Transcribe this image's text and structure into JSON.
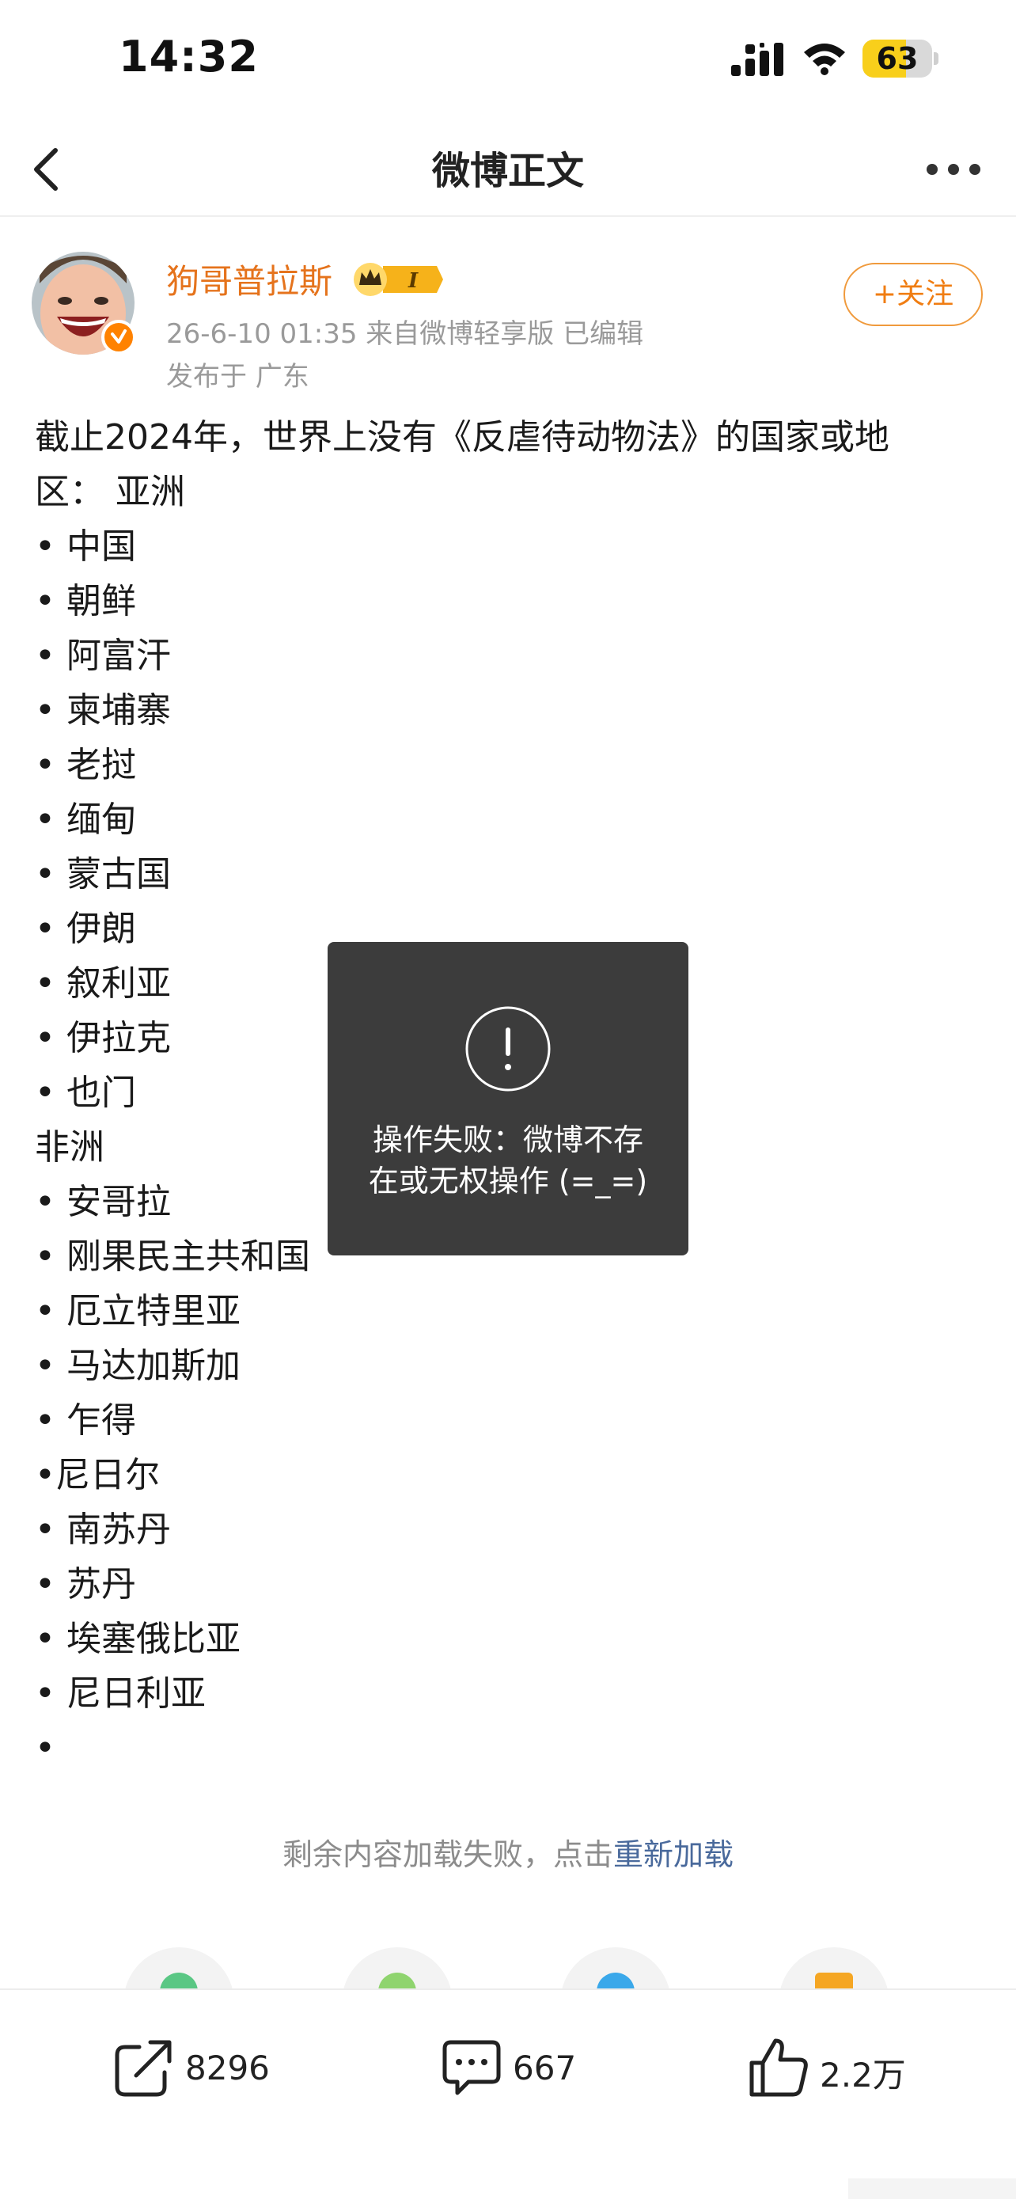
{
  "status_bar": {
    "time": "14:32",
    "battery_level": "63",
    "battery_fraction": 0.63
  },
  "nav": {
    "title": "微博正文"
  },
  "author": {
    "name": "狗哥普拉斯",
    "meta": "26-6-10 01:35  来自微博轻享版  已编辑",
    "location": "发布于 广东",
    "follow_label": "+关注"
  },
  "post": {
    "lines": [
      "截止2024年，世界上没有《反虐待动物法》的国家或地",
      "区： 亚洲",
      "• 中国",
      "• 朝鲜",
      "• 阿富汗",
      "• 柬埔寨",
      "• 老挝",
      "• 缅甸",
      "• 蒙古国",
      "• 伊朗",
      "• 叙利亚",
      "• 伊拉克",
      "• 也门",
      "非洲",
      "• 安哥拉",
      "• 刚果民主共和国",
      "• 厄立特里亚",
      "• 马达加斯加",
      "• 乍得",
      "•尼日尔",
      "• 南苏丹",
      "• 苏丹",
      "• 埃塞俄比亚",
      "• 尼日利亚",
      "•"
    ]
  },
  "toast": {
    "line1": "操作失败：微博不存",
    "line2": "在或无权操作 (=_=)"
  },
  "load_failed": {
    "text": "剩余内容加载失败，点击",
    "link": "重新加载"
  },
  "actions": {
    "repost_count": "8296",
    "comment_count": "667",
    "like_count": "2.2万"
  },
  "colors": {
    "username": "#e5731c",
    "follow": "#f07d12",
    "link": "#4a6a9c",
    "toast_bg": "#3c3c3c",
    "battery": "#f8cf1b"
  }
}
